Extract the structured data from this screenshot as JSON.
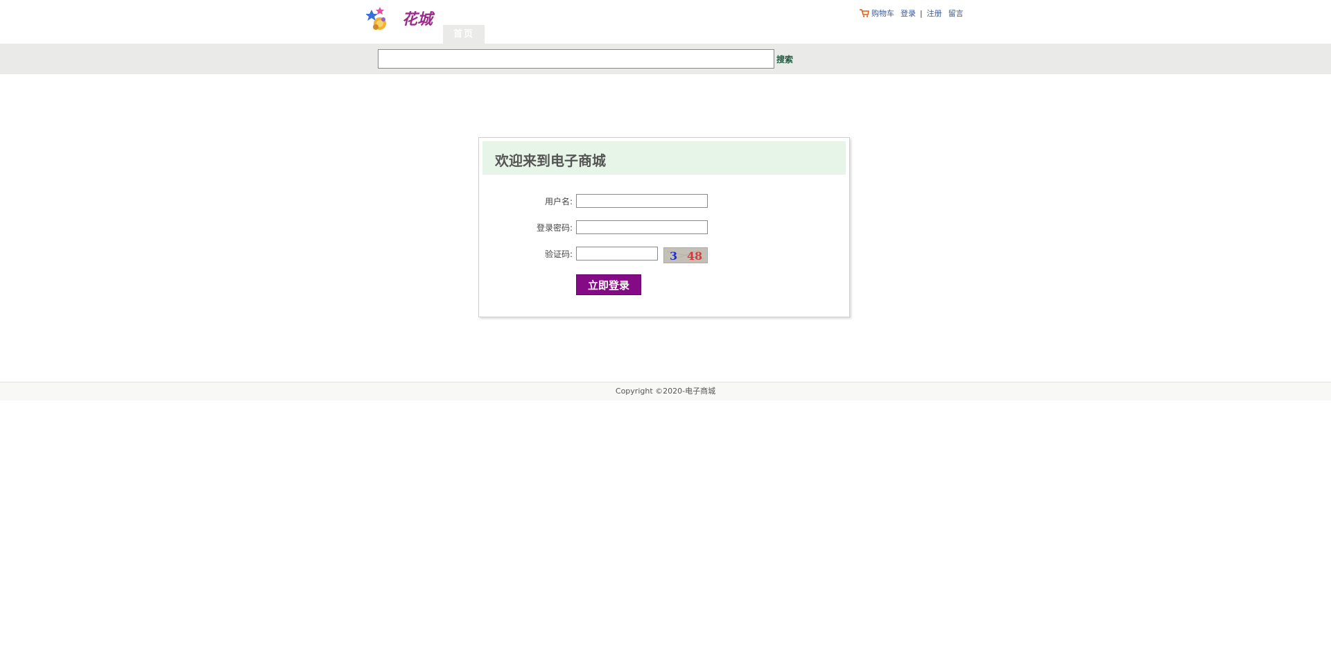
{
  "header": {
    "logo_text": "花城",
    "nav_tab": "首页",
    "links": {
      "cart": "购物车",
      "login": "登录",
      "separator": "|",
      "register": "注册",
      "message": "留言"
    }
  },
  "search": {
    "value": "",
    "button_label": "搜索"
  },
  "login": {
    "title": "欢迎来到电子商城",
    "username_label": "用户名:",
    "username_value": "",
    "password_label": "登录密码:",
    "password_value": "",
    "captcha_label": "验证码:",
    "captcha_value": "",
    "captcha_text": "3 48",
    "submit_label": "立即登录"
  },
  "footer": {
    "copyright": "Copyright ©2020-电子商城"
  },
  "colors": {
    "nav_bg": "#eaeae8",
    "title_bar_bg": "#e7f4e8",
    "login_button": "#850a85",
    "link": "#3a5a9c",
    "search_button_text": "#1d5a3f"
  }
}
